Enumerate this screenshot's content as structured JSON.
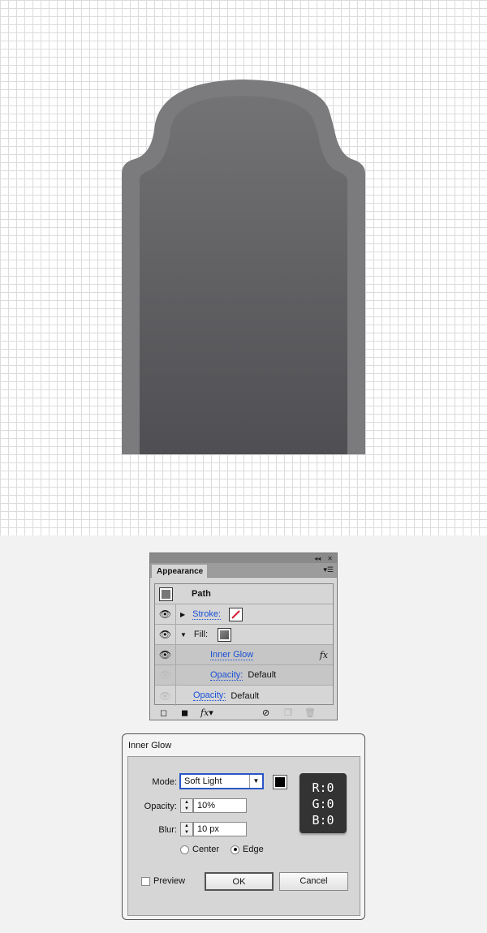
{
  "canvas": {
    "shape_fill_top": "#737375",
    "shape_fill_bottom": "#4f4f53",
    "border_color": "#7d7d80"
  },
  "appearance": {
    "title": "Appearance",
    "path_label": "Path",
    "stroke_label": "Stroke:",
    "fill_label": "Fill:",
    "effect_label": "Inner Glow",
    "fx": "fx",
    "fill_opacity_label": "Opacity:",
    "fill_opacity_value": "Default",
    "opacity_label": "Opacity:",
    "opacity_value": "Default"
  },
  "inner_glow": {
    "title": "Inner Glow",
    "mode_label": "Mode:",
    "mode_value": "Soft Light",
    "opacity_label": "Opacity:",
    "opacity_value": "10%",
    "blur_label": "Blur:",
    "blur_value": "10 px",
    "center_label": "Center",
    "edge_label": "Edge",
    "selected": "Edge",
    "preview_label": "Preview",
    "preview_checked": false,
    "ok": "OK",
    "cancel": "Cancel",
    "color": "#000000",
    "rgb": {
      "r": "R:0",
      "g": "G:0",
      "b": "B:0"
    }
  }
}
